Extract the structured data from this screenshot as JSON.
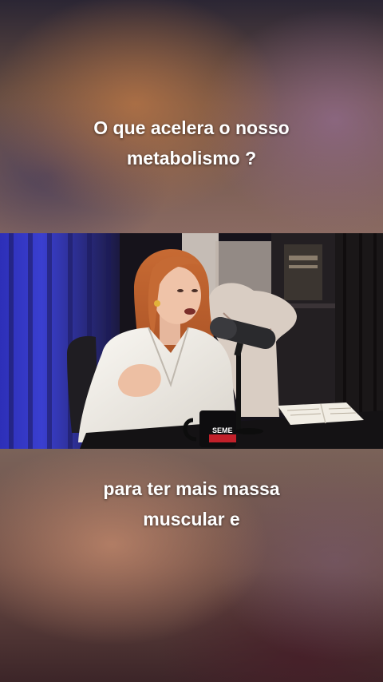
{
  "captions": {
    "top": [
      "O que acelera o nosso",
      "metabolismo ?"
    ],
    "bottom": [
      "para ter mais massa",
      "muscular e"
    ]
  },
  "video": {
    "mug_text": "SEME"
  },
  "colors": {
    "caption_text": "#ffffff",
    "curtain_blue": "#3a3fd0",
    "shirt_white": "#f2efe9",
    "hair_red": "#c0662f"
  }
}
